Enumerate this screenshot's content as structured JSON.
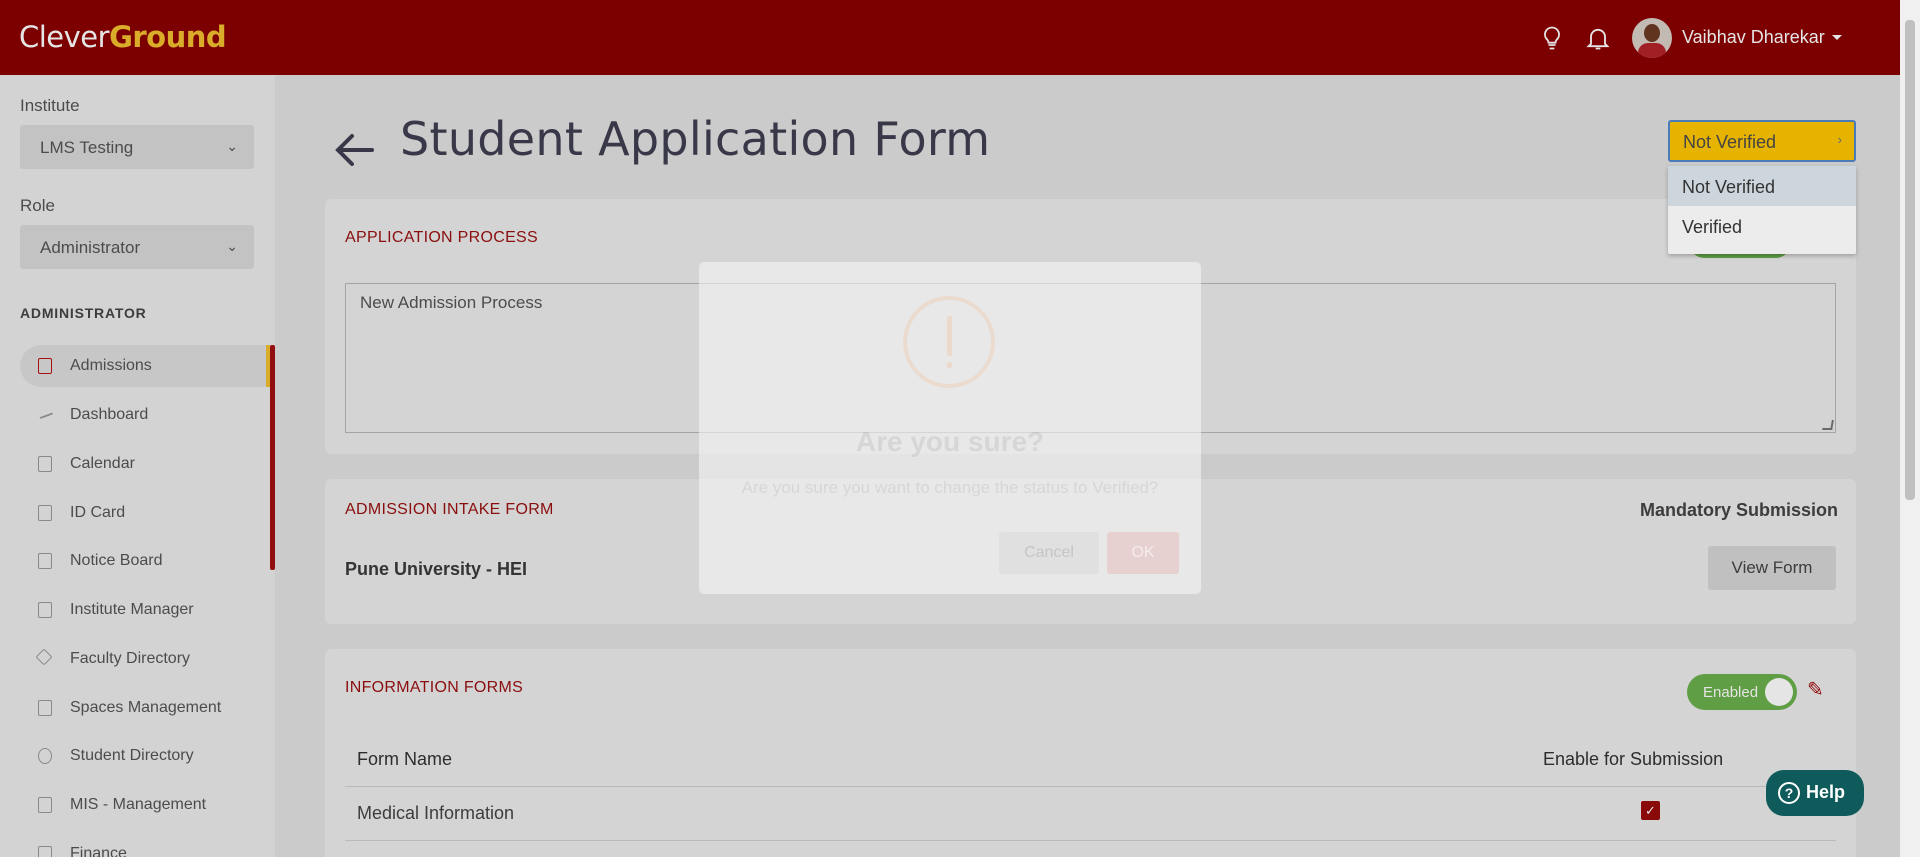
{
  "app": {
    "logo_part1": "Clever",
    "logo_part2": "Ground"
  },
  "header": {
    "user_name": "Vaibhav Dharekar",
    "icons": [
      "lightbulb-icon",
      "bell-icon"
    ]
  },
  "sidebar": {
    "institute_label": "Institute",
    "institute_value": "LMS Testing",
    "role_label": "Role",
    "role_value": "Administrator",
    "section_title": "ADMINISTRATOR",
    "items": [
      {
        "label": "Admissions",
        "active": true
      },
      {
        "label": "Dashboard"
      },
      {
        "label": "Calendar"
      },
      {
        "label": "ID Card"
      },
      {
        "label": "Notice Board"
      },
      {
        "label": "Institute Manager"
      },
      {
        "label": "Faculty Directory"
      },
      {
        "label": "Spaces Management"
      },
      {
        "label": "Student Directory"
      },
      {
        "label": "MIS - Management"
      },
      {
        "label": "Finance"
      }
    ]
  },
  "page": {
    "title": "Student Application Form",
    "status_value": "Not Verified",
    "status_options": [
      "Not Verified",
      "Verified"
    ]
  },
  "application_process": {
    "title": "APPLICATION PROCESS",
    "text": "New Admission Process"
  },
  "intake_form": {
    "title": "ADMISSION INTAKE FORM",
    "mandatory_label": "Mandatory Submission",
    "form_name": "Pune University - HEI",
    "view_button": "View Form"
  },
  "information_forms": {
    "title": "INFORMATION FORMS",
    "toggle_label": "Enabled",
    "columns": [
      "Form Name",
      "Enable for Submission"
    ],
    "rows": [
      {
        "name": "Medical Information",
        "enabled": true
      }
    ]
  },
  "modal": {
    "title": "Are you sure?",
    "text": "Are you sure you want to change the status to Verified?",
    "cancel": "Cancel",
    "ok": "OK"
  },
  "help": {
    "label": "Help"
  },
  "colors": {
    "brand": "#8c0000",
    "accent": "#f2c12e",
    "toggle": "#6ab04c",
    "help": "#0f5a5a"
  }
}
